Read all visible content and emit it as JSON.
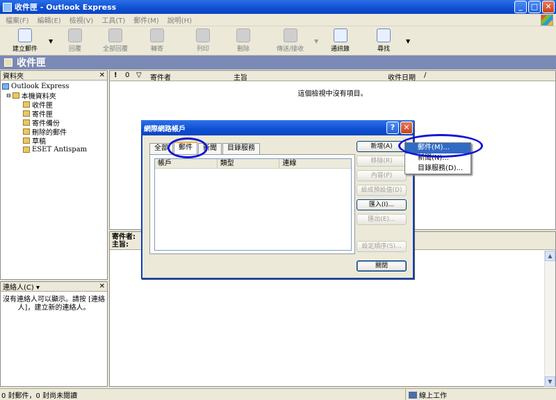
{
  "window": {
    "title": "收件匣 - Outlook Express",
    "buttons": [
      "_",
      "□",
      "✕"
    ]
  },
  "menu": [
    "檔案(F)",
    "編輯(E)",
    "檢視(V)",
    "工具(T)",
    "郵件(M)",
    "說明(H)"
  ],
  "toolbar": [
    {
      "label": "建立郵件",
      "enabled": true
    },
    {
      "label": "回覆",
      "enabled": false
    },
    {
      "label": "全部回覆",
      "enabled": false
    },
    {
      "label": "轉寄",
      "enabled": false
    },
    {
      "label": "列印",
      "enabled": false
    },
    {
      "label": "刪除",
      "enabled": false
    },
    {
      "label": "傳送/接收",
      "enabled": false
    },
    {
      "label": "通訊錄",
      "enabled": true
    },
    {
      "label": "尋找",
      "enabled": true
    }
  ],
  "folder_heading": "收件匣",
  "folders_pane": {
    "title": "資料夾",
    "close": "✕",
    "items": [
      "Outlook Express",
      "本機資料夾",
      "收件匣",
      "寄件匣",
      "寄件備份",
      "刪除的郵件",
      "草稿",
      "ESET Antispam"
    ]
  },
  "message_list": {
    "columns": [
      "!",
      "0",
      "▽",
      "寄件者",
      "主旨",
      "收件日期",
      "/"
    ],
    "empty_text": "這個檢視中沒有項目。"
  },
  "preview": {
    "from_label": "寄件者:",
    "subject_label": "主旨:"
  },
  "contacts": {
    "title": "連絡人(C) ▾",
    "close": "✕",
    "empty_text": "沒有連絡人可以顯示。請按 [連絡人]，建立新的連絡人。"
  },
  "status": {
    "left": "0 封郵件，0 封尚未閱讀",
    "right": "線上工作"
  },
  "dialog": {
    "title": "網際網路帳戶",
    "help": "?",
    "close": "✕",
    "tabs": [
      "全部",
      "郵件",
      "新聞",
      "目錄服務"
    ],
    "active_tab": "郵件",
    "columns": [
      "帳戶",
      "類型",
      "連線"
    ],
    "buttons": [
      {
        "label": "新增(A)",
        "enabled": true
      },
      {
        "label": "移除(R)",
        "enabled": false
      },
      {
        "label": "內容(P)",
        "enabled": false
      },
      {
        "label": "設成預設值(D)",
        "enabled": false
      },
      {
        "label": "匯入(I)...",
        "enabled": true
      },
      {
        "label": "匯出(E)...",
        "enabled": false
      },
      {
        "label": "設定順序(S)...",
        "enabled": false
      }
    ],
    "close_button": "關閉"
  },
  "popup_menu": [
    "郵件(M)...",
    "新聞(N)...",
    "目錄服務(D)..."
  ],
  "colors": {
    "titlebar": "#0f4fd1",
    "folder_heading": "#7b8ab4",
    "selection": "#316ac5",
    "annotation": "#1515d6"
  }
}
